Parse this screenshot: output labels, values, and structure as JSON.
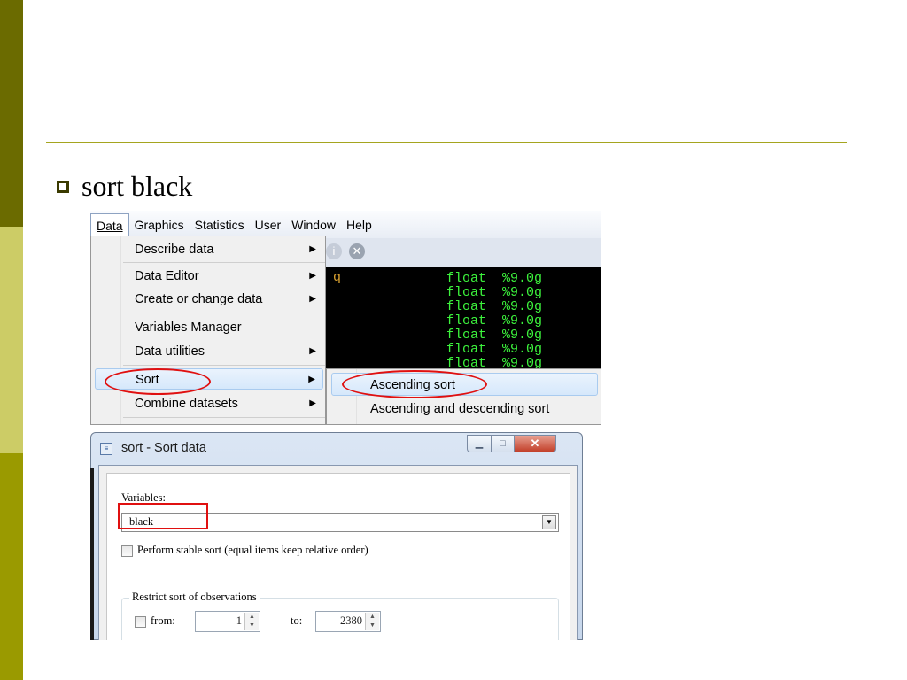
{
  "slide": {
    "bullet_text": "sort black"
  },
  "menubar": {
    "items": [
      "Data",
      "Graphics",
      "Statistics",
      "User",
      "Window",
      "Help"
    ]
  },
  "data_menu": {
    "items": [
      {
        "label": "Describe data",
        "has_submenu": true
      },
      {
        "label": "Data Editor",
        "has_submenu": true
      },
      {
        "label": "Create or change data",
        "has_submenu": true
      },
      {
        "label": "Variables Manager",
        "has_submenu": false
      },
      {
        "label": "Data utilities",
        "has_submenu": true
      },
      {
        "label": "Sort",
        "has_submenu": true
      },
      {
        "label": "Combine datasets",
        "has_submenu": true
      }
    ]
  },
  "sort_submenu": {
    "items": [
      "Ascending sort",
      "Ascending and descending sort"
    ]
  },
  "console": {
    "left_fragment": "q",
    "type_col": "float",
    "format_col": "%9.0g",
    "row_count": 7
  },
  "dialog": {
    "title": "sort - Sort data",
    "variables_label": "Variables:",
    "variables_value": "black",
    "stable_sort_label": "Perform stable sort (equal items keep relative order)",
    "restrict_group_label": "Restrict sort of observations",
    "from_label": "from:",
    "from_value": "1",
    "to_label": "to:",
    "to_value": "2380"
  },
  "colors": {
    "highlight_red": "#e01010",
    "console_green": "#3cf23c",
    "olive_dark": "#6b6b00",
    "olive_light": "#cccc66",
    "olive_mid": "#9a9a00"
  }
}
